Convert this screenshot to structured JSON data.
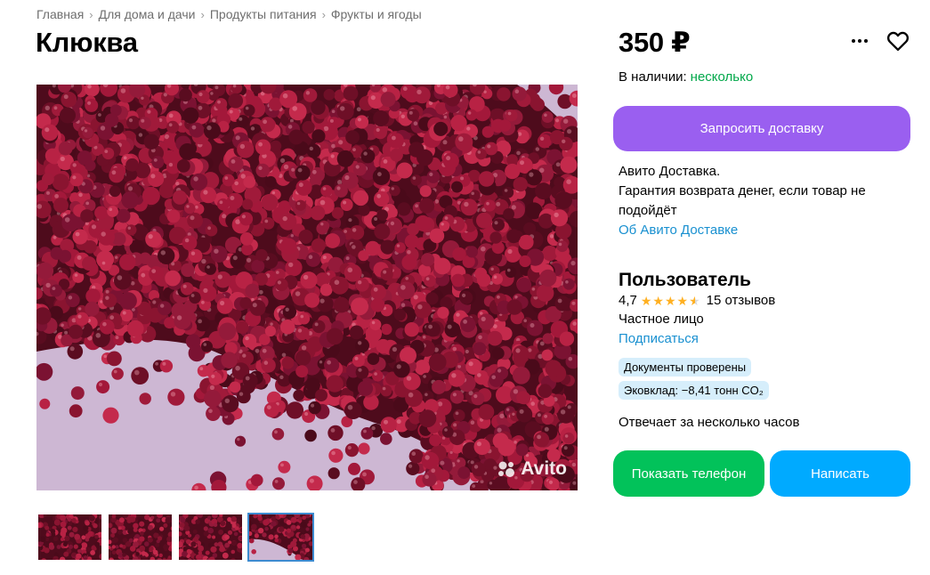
{
  "breadcrumbs": [
    "Главная",
    "Для дома и дачи",
    "Продукты питания",
    "Фрукты и ягоды"
  ],
  "breadcrumb_separator": "›",
  "listing": {
    "title": "Клюква",
    "price": "350 ₽",
    "stock_label": "В наличии:",
    "stock_value": "несколько",
    "photos_count": 4,
    "active_photo": 4,
    "watermark": "Avito"
  },
  "delivery": {
    "button_label": "Запросить доставку",
    "line1": "Авито Доставка.",
    "line2": "Гарантия возврата денег, если товар не подойдёт",
    "link": "Об Авито Доставке"
  },
  "seller": {
    "name": "Пользователь",
    "rating": "4,7",
    "rating_value": 4.7,
    "reviews": "15 отзывов",
    "type": "Частное лицо",
    "subscribe": "Подписаться",
    "badges": [
      "Документы проверены",
      "Эковклад: −8,41 тонн CO₂"
    ],
    "response_time": "Отвечает за несколько часов"
  },
  "actions": {
    "phone": "Показать телефон",
    "write": "Написать"
  },
  "colors": {
    "purple": "#9a5ff0",
    "green": "#02c25a",
    "blue": "#00aaff",
    "stock_green": "#02a84a",
    "link": "#1990d0",
    "badge_bg": "#d6eefb",
    "star": "#ffb021"
  }
}
